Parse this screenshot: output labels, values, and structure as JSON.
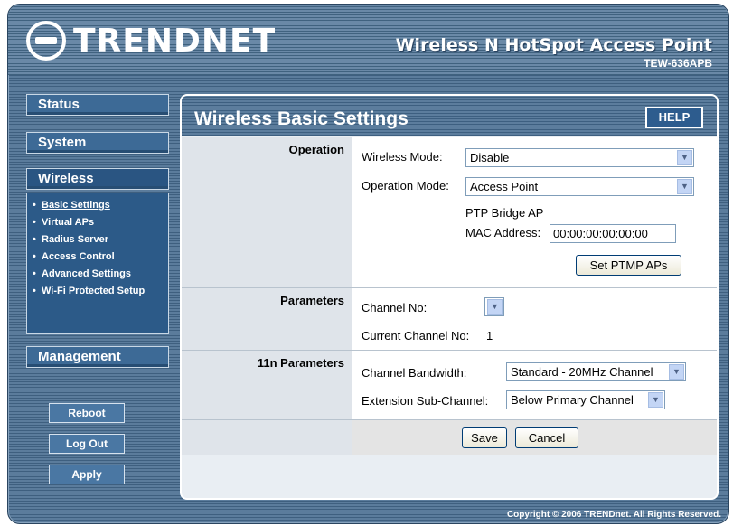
{
  "header": {
    "brand": "TRENDNET",
    "product_title": "Wireless N HotSpot Access Point",
    "model": "TEW-636APB"
  },
  "nav": {
    "status": "Status",
    "system": "System",
    "wireless": "Wireless",
    "management": "Management",
    "wireless_items": [
      {
        "label": "Basic Settings"
      },
      {
        "label": "Virtual APs"
      },
      {
        "label": "Radius Server"
      },
      {
        "label": "Access Control"
      },
      {
        "label": "Advanced Settings"
      },
      {
        "label": "Wi-Fi Protected Setup"
      }
    ],
    "bullet": "•"
  },
  "side_buttons": {
    "reboot": "Reboot",
    "logout": "Log Out",
    "apply": "Apply"
  },
  "panel": {
    "title": "Wireless Basic Settings",
    "help": "HELP"
  },
  "operation": {
    "section": "Operation",
    "wireless_mode_label": "Wireless Mode:",
    "wireless_mode_value": "Disable",
    "operation_mode_label": "Operation Mode:",
    "operation_mode_value": "Access Point",
    "ptp_label": "PTP Bridge AP",
    "mac_label": "MAC Address:",
    "mac_value": "00:00:00:00:00:00",
    "set_ptmp": "Set PTMP APs"
  },
  "parameters": {
    "section": "Parameters",
    "channel_label": "Channel No:",
    "channel_value": "",
    "current_channel_label": "Current Channel No:",
    "current_channel_value": "1"
  },
  "n_parameters": {
    "section": "11n Parameters",
    "bandwidth_label": "Channel Bandwidth:",
    "bandwidth_value": "Standard - 20MHz Channel",
    "ext_label": "Extension Sub-Channel:",
    "ext_value": "Below Primary Channel"
  },
  "actions": {
    "save": "Save",
    "cancel": "Cancel"
  },
  "footer": {
    "copyright": "Copyright © 2006 TRENDnet. All Rights Reserved."
  },
  "icons": {
    "dropdown_arrow": "▼"
  }
}
